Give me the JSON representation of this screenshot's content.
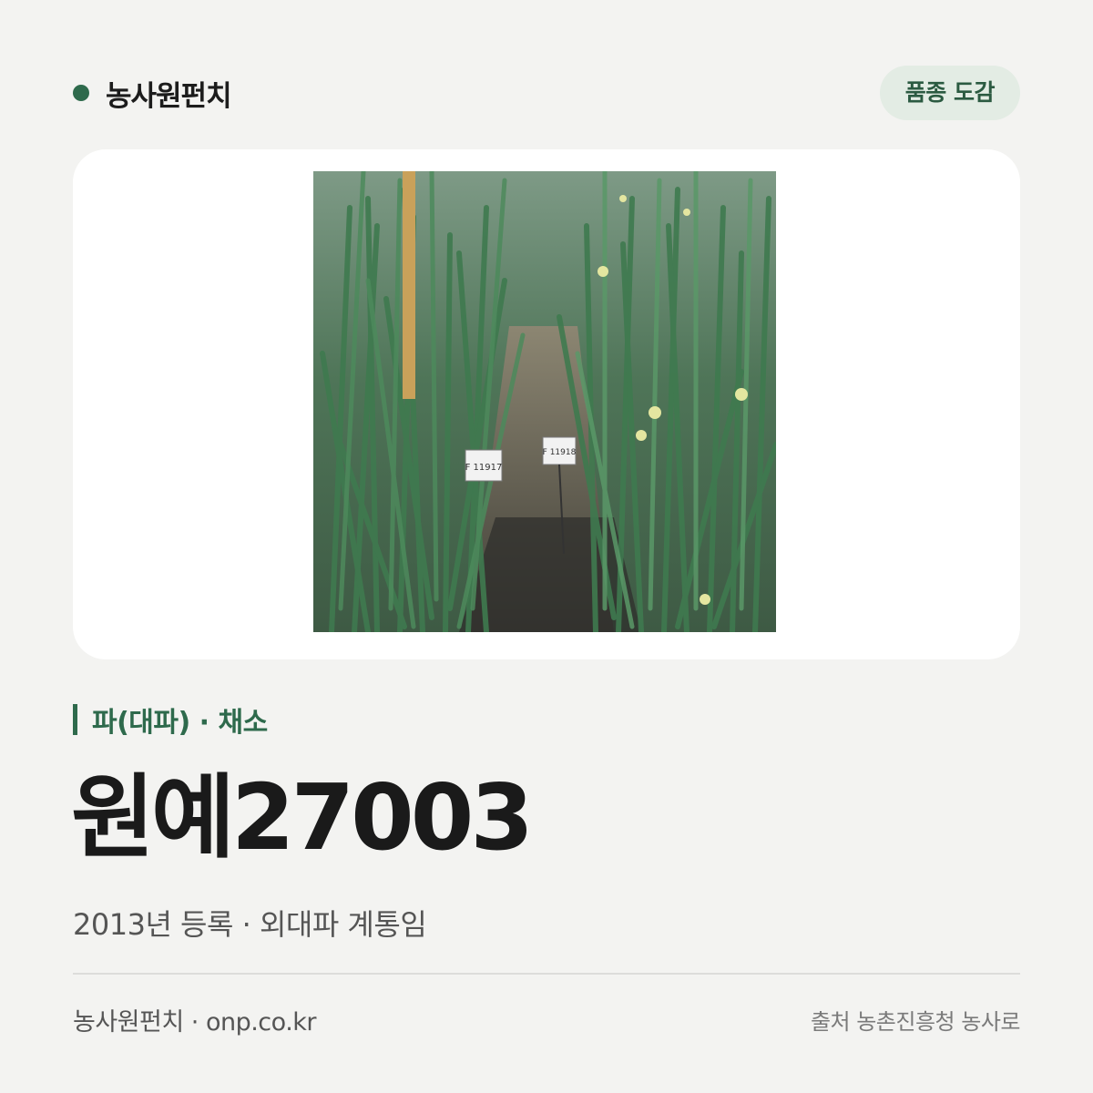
{
  "header": {
    "brand_name": "농사원펀치",
    "tag_label": "품종 도감"
  },
  "photo": {
    "icon": "scallion-field-photo",
    "marker_label_left": "F 11917",
    "marker_label_right": "F 11918"
  },
  "info": {
    "category": "파(대파) · 채소",
    "variety_name": "원예27003",
    "description": "2013년 등록 · 외대파 계통임"
  },
  "footer": {
    "site": "농사원펀치 · onp.co.kr",
    "source": "출처 농촌진흥청 농사로"
  },
  "colors": {
    "accent": "#2e6a4c",
    "background": "#f3f3f1",
    "pill_background": "#e3ece4"
  }
}
